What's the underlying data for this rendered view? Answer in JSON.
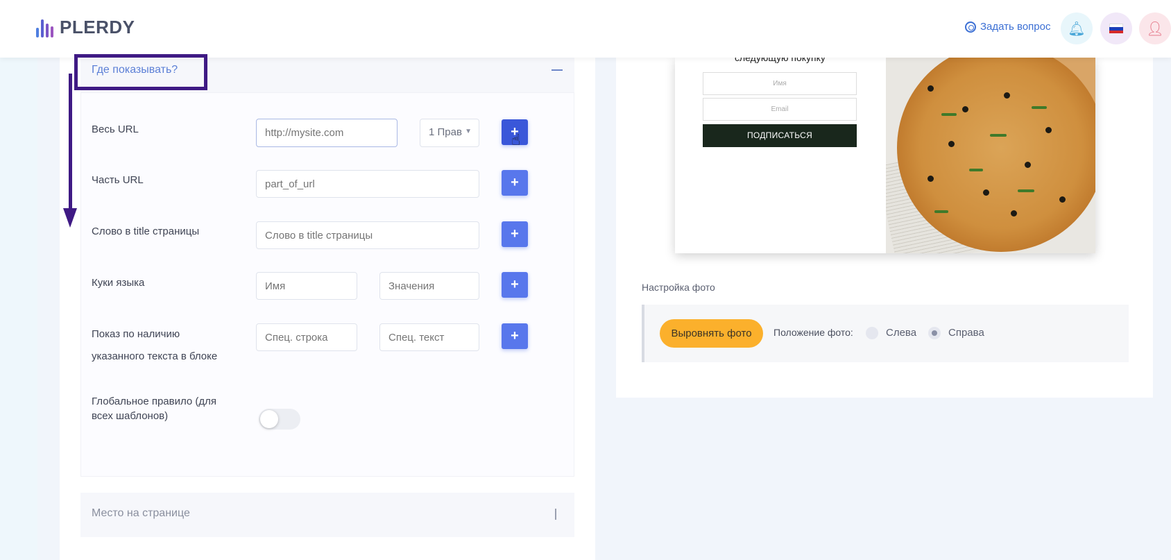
{
  "header": {
    "logo_text": "PLERDY",
    "ask_label": "Задать вопрос"
  },
  "where_section": {
    "title": "Где показывать?",
    "full_url": {
      "label": "Весь URL",
      "placeholder": "http://mysite.com",
      "select_value": "1 Прав"
    },
    "part_url": {
      "label": "Часть URL",
      "placeholder": "part_of_url"
    },
    "title_word": {
      "label": "Слово в title страницы",
      "placeholder": "Слово в title страницы"
    },
    "lang_cookie": {
      "label": "Куки языка",
      "name_placeholder": "Имя",
      "value_placeholder": "Значения"
    },
    "text_in_block": {
      "label_line1": "Показ по наличию",
      "label_line2": "указанного текста в блоке",
      "row_placeholder": "Спец. строка",
      "text_placeholder": "Спец. текст"
    },
    "global_rule": {
      "label_line1": "Глобальное правило (для",
      "label_line2": "всех шаблонов)",
      "enabled": false
    }
  },
  "place_section": {
    "title": "Место на странице"
  },
  "preview": {
    "top_text": "следующую покупку",
    "name_placeholder": "Имя",
    "email_placeholder": "Email",
    "subscribe_label": "ПОДПИСАТЬСЯ"
  },
  "photo_settings": {
    "title": "Настройка фото",
    "align_button": "Выровнять фото",
    "position_label": "Положение фото:",
    "option_left": "Слева",
    "option_right": "Справа",
    "selected": "Справа"
  },
  "colors": {
    "accent_blue": "#5877ec",
    "annotation_purple": "#3f1a84",
    "align_button_yellow": "#fbb02c"
  }
}
